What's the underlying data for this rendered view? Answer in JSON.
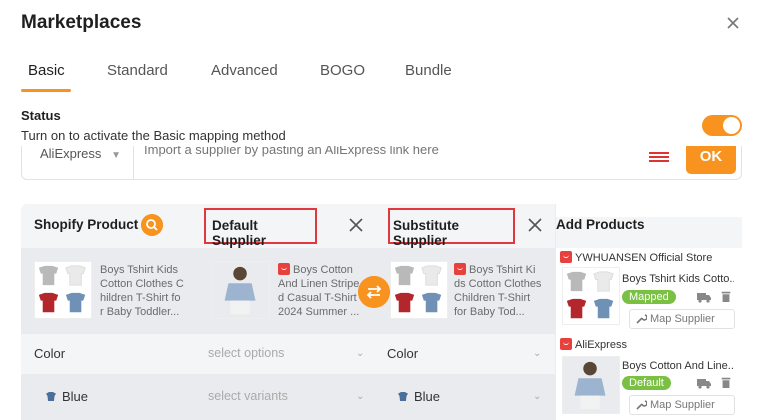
{
  "header": {
    "title": "Marketplaces",
    "close_icon": "close-icon"
  },
  "tabs": [
    {
      "label": "Basic",
      "active": true
    },
    {
      "label": "Standard",
      "active": false
    },
    {
      "label": "Advanced",
      "active": false
    },
    {
      "label": "BOGO",
      "active": false
    },
    {
      "label": "Bundle",
      "active": false
    }
  ],
  "status": {
    "title": "Status",
    "description": "Turn on to activate the Basic mapping method",
    "enabled": true
  },
  "import": {
    "source": "AliExpress",
    "placeholder": "Import a supplier by pasting an AliExpress link here",
    "ok_label": "OK"
  },
  "columns": {
    "shopify": "Shopify Product",
    "default": "Default Supplier",
    "substitute": "Substitute Supplier",
    "add": "Add Products"
  },
  "products": {
    "shopify": {
      "title_lines": [
        "Boys Tshirt Kids",
        "Cotton Clothes C",
        "hildren T-Shirt fo",
        "r Baby Toddler..."
      ]
    },
    "default": {
      "title_lines": [
        "Boys Cotton",
        "And Linen Stripe",
        "d Casual T-Shirt",
        "2024 Summer ..."
      ]
    },
    "substitute": {
      "title_lines": [
        "Boys Tshirt Ki",
        "ds Cotton Clothes",
        "Children T-Shirt",
        "for Baby Tod..."
      ]
    }
  },
  "options": {
    "row1": {
      "label": "Color",
      "placeholder": "select options",
      "value": "Color"
    },
    "row2": {
      "label": "Blue",
      "placeholder": "select variants",
      "value": "Blue"
    }
  },
  "add_products": [
    {
      "store": "YWHUANSEN Official Store",
      "title": "Boys Tshirt Kids Cotto...",
      "badge": "Mapped",
      "map_label": "Map Supplier"
    },
    {
      "store": "AliExpress",
      "title": "Boys Cotton And Line...",
      "badge": "Default",
      "map_label": "Map Supplier"
    }
  ],
  "colors": {
    "accent": "#f7931e",
    "highlight_border": "#e0383e",
    "badge_green": "#7ac143",
    "ali_red": "#e8403d"
  }
}
